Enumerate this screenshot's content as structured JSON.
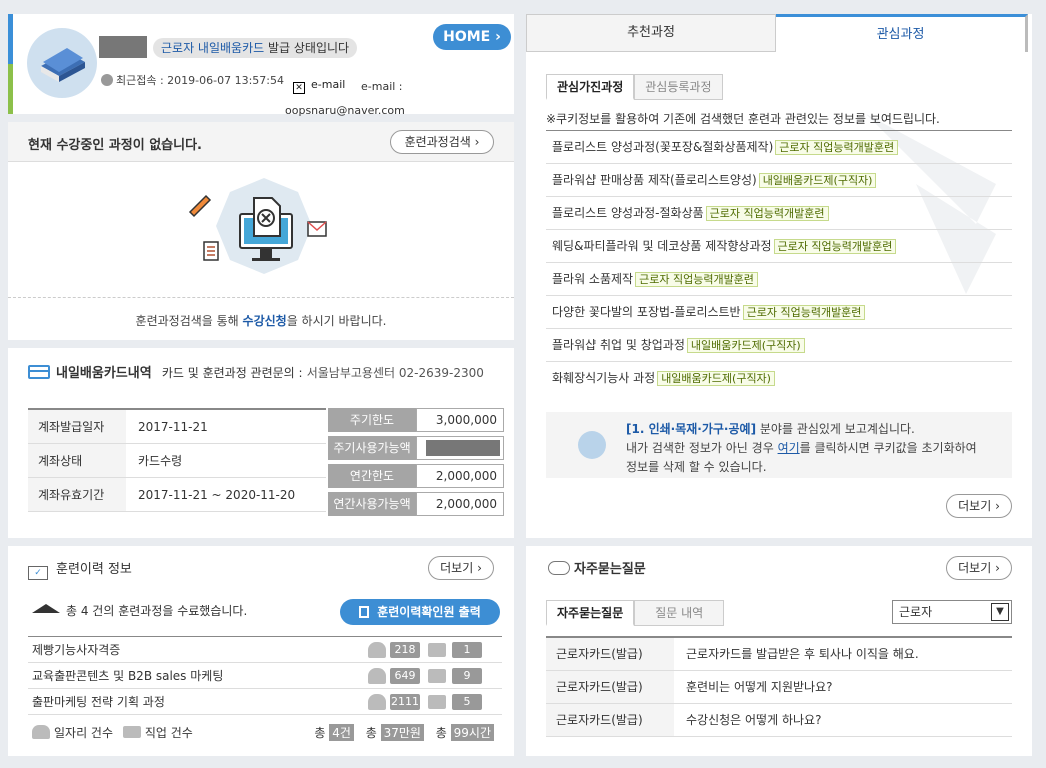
{
  "profile": {
    "status_highlight": "근로자 내일배움카드",
    "status_rest": " 발급 상태입니다",
    "home_label": "HOME",
    "last_login": "최근접속 : 2019-06-07 13:57:54",
    "email_label": "e-mail",
    "email_label2": "e-mail :",
    "email_value": "oopsnaru@naver.com"
  },
  "current_course": {
    "title": "현재 수강중인 과정이 없습니다.",
    "search_button": "훈련과정검색",
    "message_pre": "훈련과정검색을 통해 ",
    "message_link": "수강신청",
    "message_post": "을 하시기 바랍니다."
  },
  "card": {
    "title": "내일배움카드내역",
    "inquiry_label": "카드 및 훈련과정 관련문의 :",
    "inquiry_value": "서울남부고용센터 02-2639-2300",
    "rows": [
      {
        "k": "계좌발급일자",
        "v": "2017-11-21"
      },
      {
        "k": "계좌상태",
        "v": "카드수령"
      },
      {
        "k": "계좌유효기간",
        "v": "2017-11-21 ~ 2020-11-20"
      }
    ],
    "amounts": [
      {
        "k": "주기한도",
        "v": "3,000,000"
      },
      {
        "k": "주기사용가능액",
        "v": ""
      },
      {
        "k": "연간한도",
        "v": "2,000,000"
      },
      {
        "k": "연간사용가능액",
        "v": "2,000,000"
      }
    ]
  },
  "history": {
    "title": "훈련이력 정보",
    "more_button": "더보기",
    "summary": "총 4 건의 훈련과정을 수료했습니다.",
    "print_button": "훈련이력확인원 출력",
    "rows": [
      {
        "name": "제빵기능사자격증",
        "jobs": "218",
        "jobcnt": "1"
      },
      {
        "name": "교육출판콘텐츠 및 B2B sales 마케팅",
        "jobs": "649",
        "jobcnt": "9"
      },
      {
        "name": "출판마케팅 전략 기획 과정",
        "jobs": "2111",
        "jobcnt": "5"
      }
    ],
    "legend_jobs": "일자리 건수",
    "legend_jobcnt": "직업 건수",
    "total_prefix": "총",
    "total_count": "4건",
    "total_amount": "37만원",
    "total_hours": "99시간"
  },
  "interest": {
    "tab_recommend": "추천과정",
    "tab_interest": "관심과정",
    "subtab_interested": "관심가진과정",
    "subtab_registered": "관심등록과정",
    "intro": "※쿠키정보를 활용하여 기존에 검색했던 훈련과 관련있는 정보를 보여드립니다.",
    "items": [
      {
        "name": "플로리스트 양성과정(꽃포장&절화상품제작)",
        "tag": "근로자 직업능력개발훈련"
      },
      {
        "name": "플라워샵 판매상품 제작(플로리스트양성)",
        "tag": "내일배움카드제(구직자)"
      },
      {
        "name": "플로리스트 양성과정-절화상품",
        "tag": "근로자 직업능력개발훈련"
      },
      {
        "name": "웨딩&파티플라워 및 데코상품 제작향상과정",
        "tag": "근로자 직업능력개발훈련"
      },
      {
        "name": "플라워 소품제작",
        "tag": "근로자 직업능력개발훈련"
      },
      {
        "name": "다양한 꽃다발의 포장법-플로리스트반",
        "tag": "근로자 직업능력개발훈련"
      },
      {
        "name": "플라워샵 취업 및 창업과정",
        "tag": "내일배움카드제(구직자)"
      },
      {
        "name": "화훼장식기능사 과정",
        "tag": "내일배움카드제(구직자)"
      }
    ],
    "note_field": "[1. 인쇄·목재·가구·공예]",
    "note_line1_rest": " 분야를 관심있게 보고계십니다.",
    "note_line2_pre": "내가 검색한 정보가 아닌 경우 ",
    "note_link": "여기",
    "note_line2_post": "를 클릭하시면 쿠키값을 초기화하여",
    "note_line3": "정보를 삭제 할 수 있습니다.",
    "more_button": "더보기"
  },
  "faq": {
    "title": "자주묻는질문",
    "more_button": "더보기",
    "tab_faq": "자주묻는질문",
    "tab_qna": "질문 내역",
    "select_value": "근로자",
    "rows": [
      {
        "k": "근로자카드(발급)",
        "v": "근로자카드를 발급받은 후 퇴사나 이직을 해요."
      },
      {
        "k": "근로자카드(발급)",
        "v": "훈련비는 어떻게 지원받나요?"
      },
      {
        "k": "근로자카드(발급)",
        "v": "수강신청은 어떻게 하나요?"
      }
    ]
  }
}
